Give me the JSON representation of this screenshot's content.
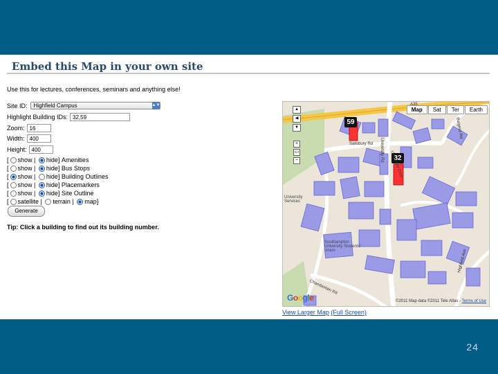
{
  "slide": {
    "number": "24"
  },
  "heading": "Embed this Map in your own site",
  "form": {
    "intro": "Use this for lectures, conferences, seminars and anything else!",
    "site_label": "Site ID:",
    "site_value": "Highfield Campus",
    "highlight_label": "Highlight Building IDs:",
    "highlight_value": "32,59",
    "zoom_label": "Zoom:",
    "zoom_value": "16",
    "width_label": "Width:",
    "width_value": "400",
    "height_label": "Height:",
    "height_value": "400",
    "toggles": [
      {
        "show": "show",
        "hide": "hide]",
        "label": "Amenities",
        "selected": "hide"
      },
      {
        "show": "show",
        "hide": "hide]",
        "label": "Bus Stops",
        "selected": "hide"
      },
      {
        "show": "show",
        "hide": "hide]",
        "label": "Building Outlines",
        "selected": "show"
      },
      {
        "show": "show",
        "hide": "hide]",
        "label": "Placemarkers",
        "selected": "hide"
      },
      {
        "show": "show",
        "hide": "hide]",
        "label": "Site Outline",
        "selected": "hide"
      }
    ],
    "maptype": {
      "satellite": "satellite",
      "terrain": "terrain",
      "map": "map]",
      "selected": "map"
    },
    "generate_label": "Generate",
    "tip": "Tip: Click a building to find out its building number."
  },
  "map": {
    "types": [
      "Map",
      "Sat",
      "Ter",
      "Earth"
    ],
    "active_type": "Map",
    "markers": [
      {
        "label": "59"
      },
      {
        "label": "32"
      }
    ],
    "roads": {
      "salisbury": "Salisbury Rd",
      "university": "University Rd",
      "chamberlain": "Chamberlain Rd",
      "burgess": "Burgess Rd",
      "highfield": "Highfield Ave",
      "uni_cres": "University Cres",
      "a35": "A35"
    },
    "places": {
      "services": "University Services",
      "union": "Southampton University Students' Union"
    },
    "google": "Google",
    "footer_data": "Map data ©2011 Tele Atlas -",
    "footer_terms": "Terms of Use",
    "footer_year": "©2011"
  },
  "links": {
    "larger_map": "View Larger Map",
    "full_screen": "(Full Screen)"
  },
  "colors": {
    "band": "#005b85",
    "building": "#9a9ae6",
    "highlight": "#ff3333",
    "road_main": "#f6c645"
  }
}
